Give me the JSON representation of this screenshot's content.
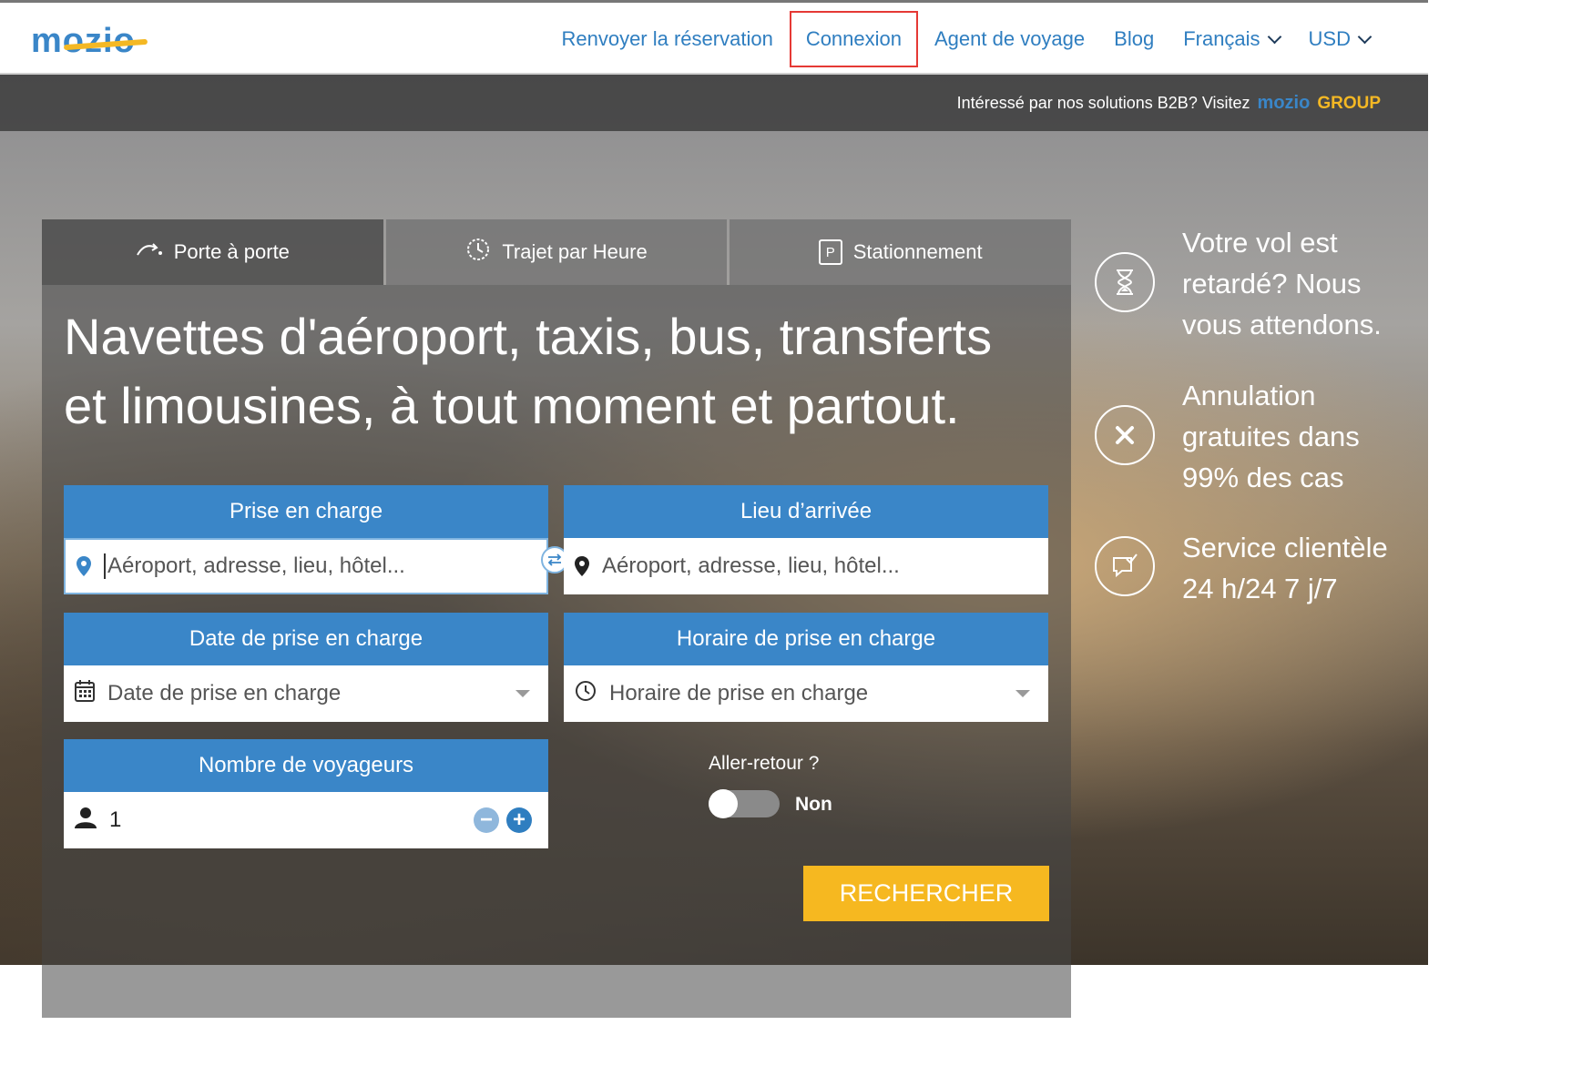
{
  "header": {
    "logo": "mozio",
    "nav": [
      {
        "label": "Renvoyer la réservation"
      },
      {
        "label": "Connexion"
      },
      {
        "label": "Agent de voyage"
      },
      {
        "label": "Blog"
      },
      {
        "label": "Français"
      },
      {
        "label": "USD"
      }
    ]
  },
  "b2b": {
    "text": "Intéressé par nos solutions B2B? Visitez",
    "brand": "mozio",
    "group": "GROUP"
  },
  "tabs": [
    {
      "label": "Porte à porte",
      "icon": "curved-arrow-icon"
    },
    {
      "label": "Trajet par Heure",
      "icon": "clock-icon"
    },
    {
      "label": "Stationnement",
      "icon": "parking-icon",
      "icon_text": "P"
    }
  ],
  "headline": "Navettes d'aéroport, taxis, bus, transferts et limousines, à tout moment et partout.",
  "form": {
    "pickup": {
      "label": "Prise en charge",
      "placeholder": "Aéroport, adresse, lieu, hôtel..."
    },
    "dropoff": {
      "label": "Lieu d’arrivée",
      "placeholder": "Aéroport, adresse, lieu, hôtel..."
    },
    "date": {
      "label": "Date de prise en charge",
      "placeholder": "Date de prise en charge"
    },
    "time": {
      "label": "Horaire de prise en charge",
      "placeholder": "Horaire de prise en charge"
    },
    "travelers": {
      "label": "Nombre de voyageurs",
      "value": "1"
    },
    "round_trip": {
      "label": "Aller-retour ?",
      "state": "Non"
    },
    "search_label": "RECHERCHER"
  },
  "features": [
    {
      "lines": [
        "Votre vol est",
        "retardé? Nous",
        "vous attendons."
      ],
      "icon": "hourglass-icon"
    },
    {
      "lines": [
        "Annulation",
        "gratuites dans",
        "99% des cas"
      ],
      "icon": "cancel-icon"
    },
    {
      "lines": [
        "Service clientèle",
        "24 h/24 7 j/7"
      ],
      "icon": "chat-icon"
    }
  ],
  "colors": {
    "primary": "#3a86c8",
    "accent": "#f6b820",
    "highlight": "#e53935"
  }
}
